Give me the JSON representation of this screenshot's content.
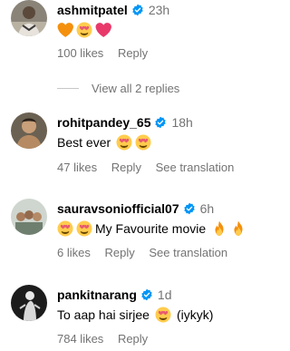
{
  "comments": [
    {
      "username": "ashmitpatel",
      "time": "23h",
      "text": "",
      "emojis": [
        "orange-heart-emoji",
        "heart-eyes-emoji",
        "pink-heart-emoji"
      ],
      "likes": "100 likes",
      "reply": "Reply",
      "see_translation": ""
    },
    {
      "username": "rohitpandey_65",
      "time": "18h",
      "text": "Best ever",
      "emojis": [
        "heart-eyes-emoji",
        "heart-eyes-emoji"
      ],
      "likes": "47 likes",
      "reply": "Reply",
      "see_translation": "See translation"
    },
    {
      "username": "sauravsoniofficial07",
      "time": "6h",
      "text": "My Favourite movie",
      "emojis": [
        "heart-eyes-emoji",
        "heart-eyes-emoji",
        "fire-emoji",
        "fire-emoji"
      ],
      "likes": "6 likes",
      "reply": "Reply",
      "see_translation": "See translation"
    },
    {
      "username": "pankitnarang",
      "time": "1d",
      "text": "To aap hai sirjee",
      "text_suffix": "(iykyk)",
      "emojis": [
        "heart-eyes-emoji"
      ],
      "likes": "784 likes",
      "reply": "Reply",
      "see_translation": ""
    }
  ],
  "view_replies": "View all 2 replies",
  "colors": {
    "verified_blue": "#0095f6",
    "secondary_text": "#737373",
    "divider": "#c7c7c7"
  }
}
